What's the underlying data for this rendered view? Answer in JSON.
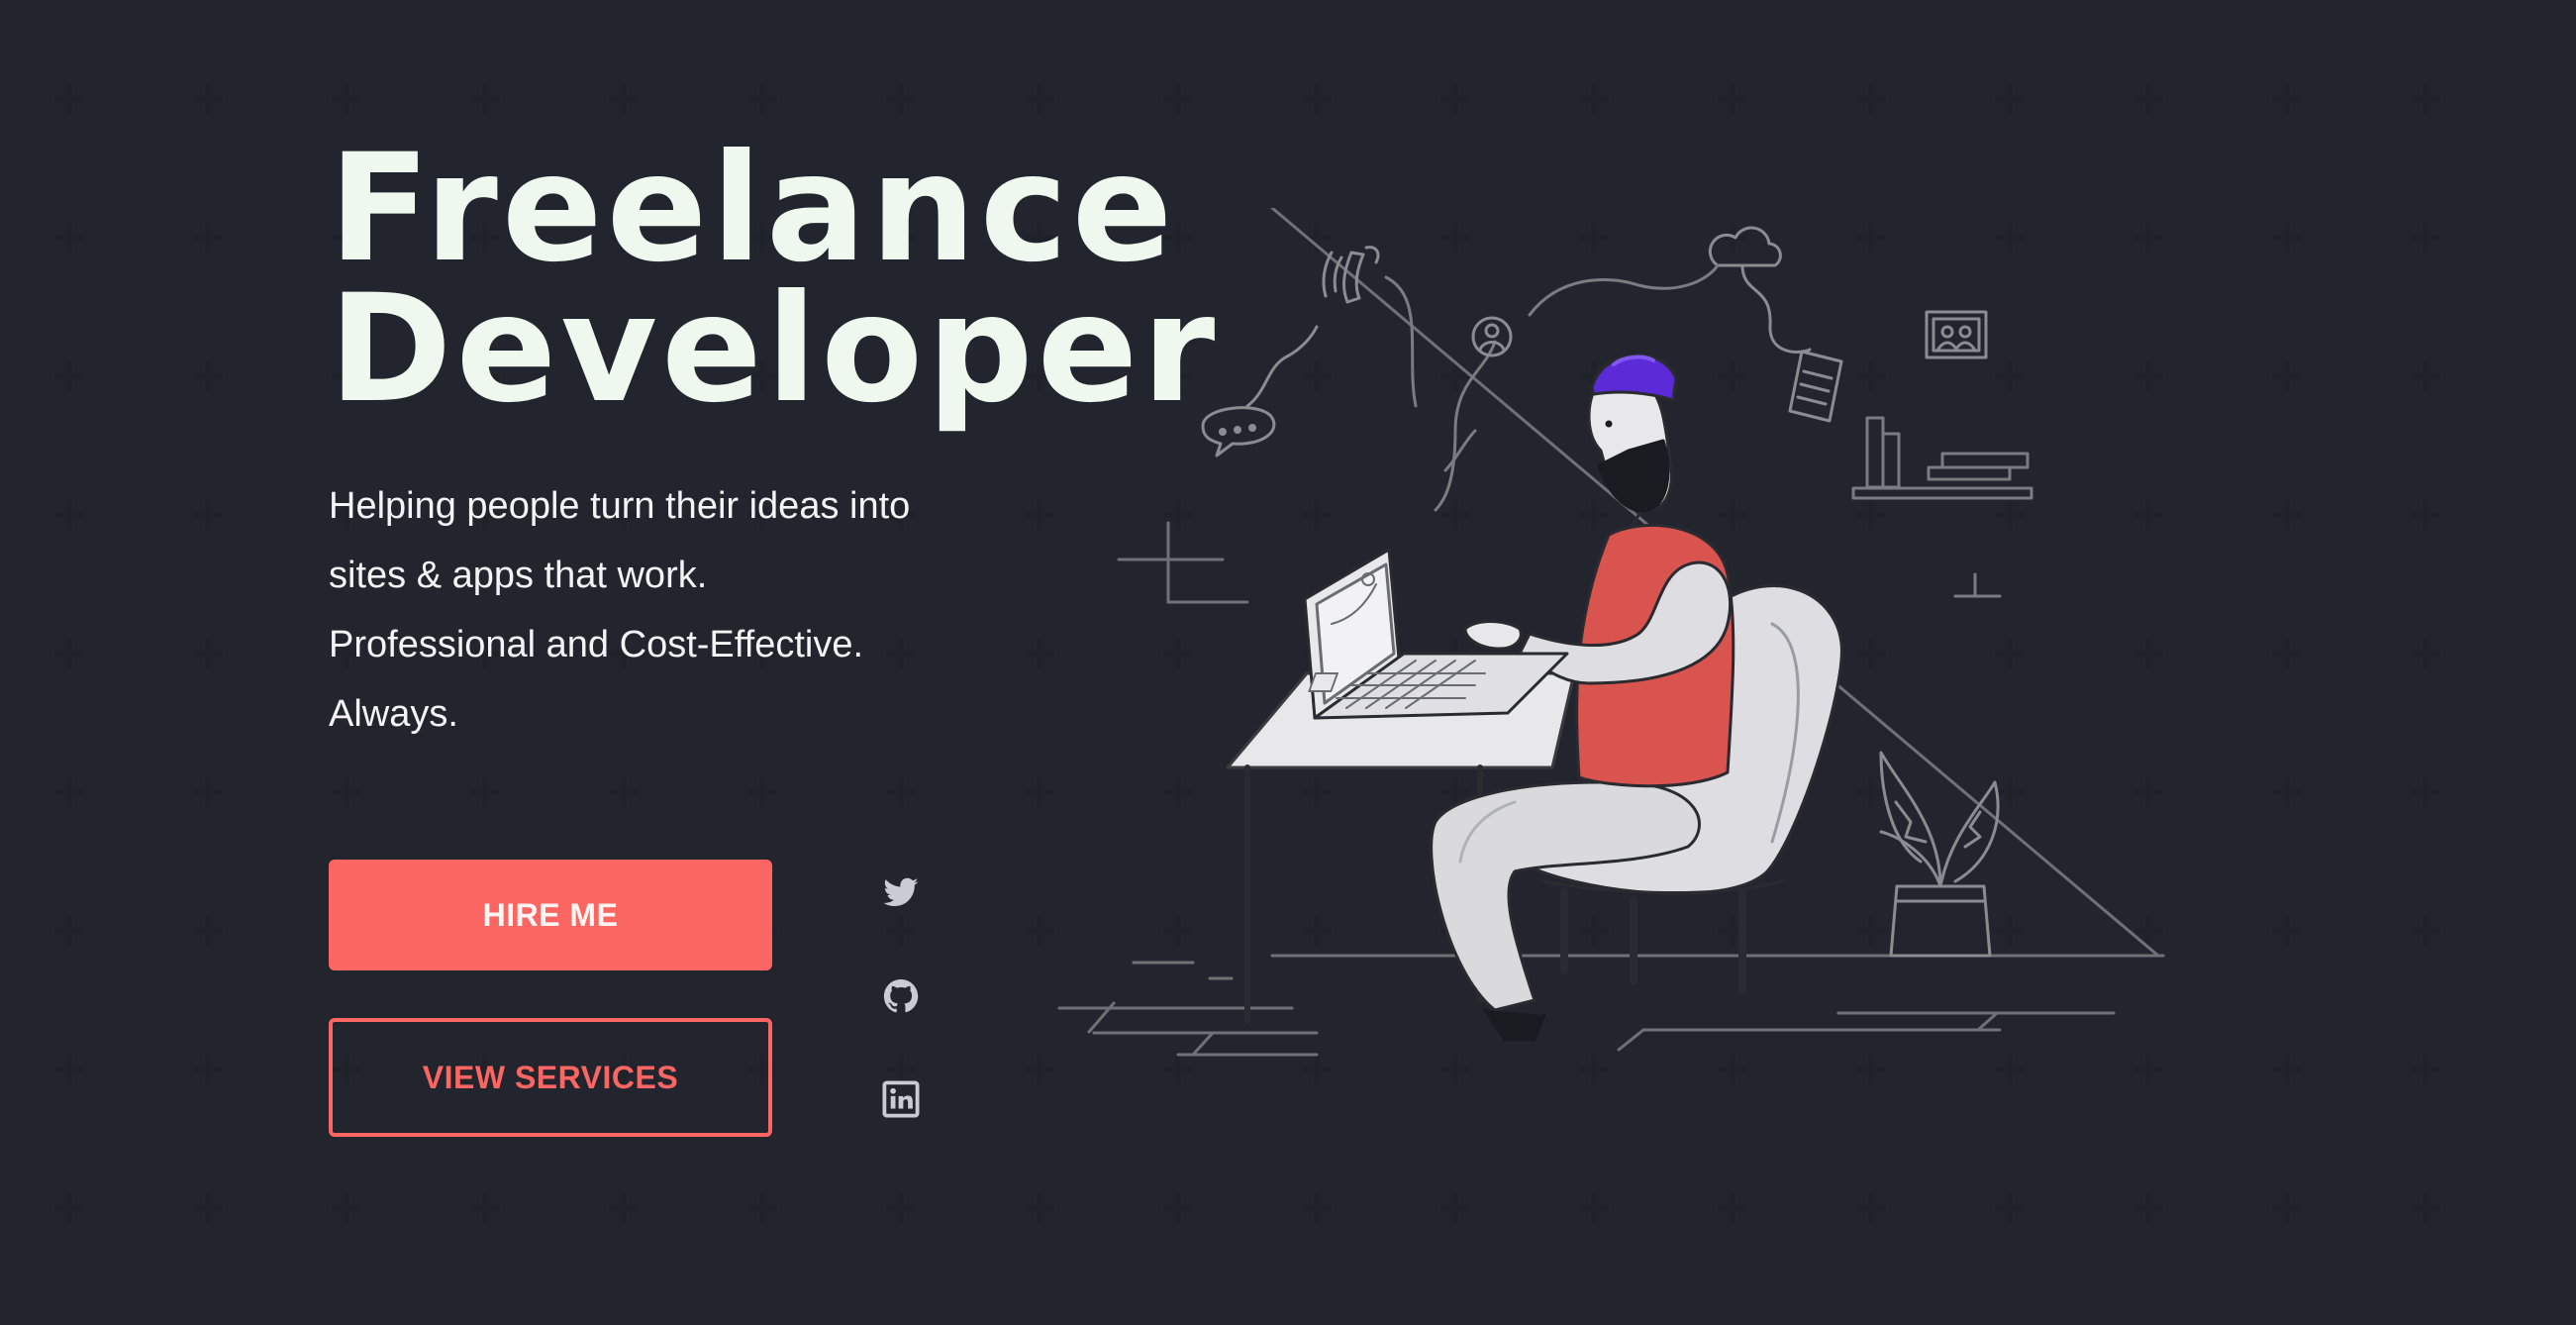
{
  "hero": {
    "title_line1": "Freelance",
    "title_line2": "Developer",
    "tagline": [
      "Helping people turn their ideas into",
      "sites & apps that work.",
      "Professional and Cost-Effective.",
      "Always."
    ]
  },
  "actions": {
    "hire_label": "HIRE ME",
    "services_label": "VIEW SERVICES"
  },
  "social": [
    {
      "name": "twitter-icon"
    },
    {
      "name": "github-icon"
    },
    {
      "name": "linkedin-icon"
    }
  ],
  "colors": {
    "background": "#181920",
    "accent": "#fb6662",
    "title": "#eef8ef",
    "hat": "#5b2bd8",
    "vest": "#d9534f"
  }
}
